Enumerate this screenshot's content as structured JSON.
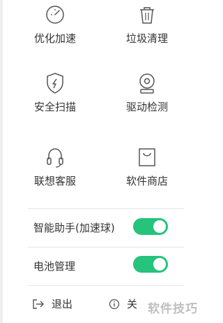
{
  "tiles": [
    {
      "label": "优化加速",
      "icon": "speedometer-icon"
    },
    {
      "label": "垃圾清理",
      "icon": "trash-icon"
    },
    {
      "label": "安全扫描",
      "icon": "shield-icon"
    },
    {
      "label": "驱动检测",
      "icon": "webcam-icon"
    },
    {
      "label": "联想客服",
      "icon": "headset-icon"
    },
    {
      "label": "软件商店",
      "icon": "shopping-bag-icon"
    }
  ],
  "toggles": [
    {
      "label": "智能助手(加速球)",
      "state": "on"
    },
    {
      "label": "电池管理",
      "state": "on"
    }
  ],
  "footer": {
    "exit_label": "退出",
    "about_label": "关",
    "exit_icon": "exit-icon",
    "about_icon": "info-icon"
  },
  "watermark": "软件技巧",
  "colors": {
    "toggle_on": "#25c37b",
    "icon_stroke": "#555555",
    "divider": "#e6e6e6"
  }
}
